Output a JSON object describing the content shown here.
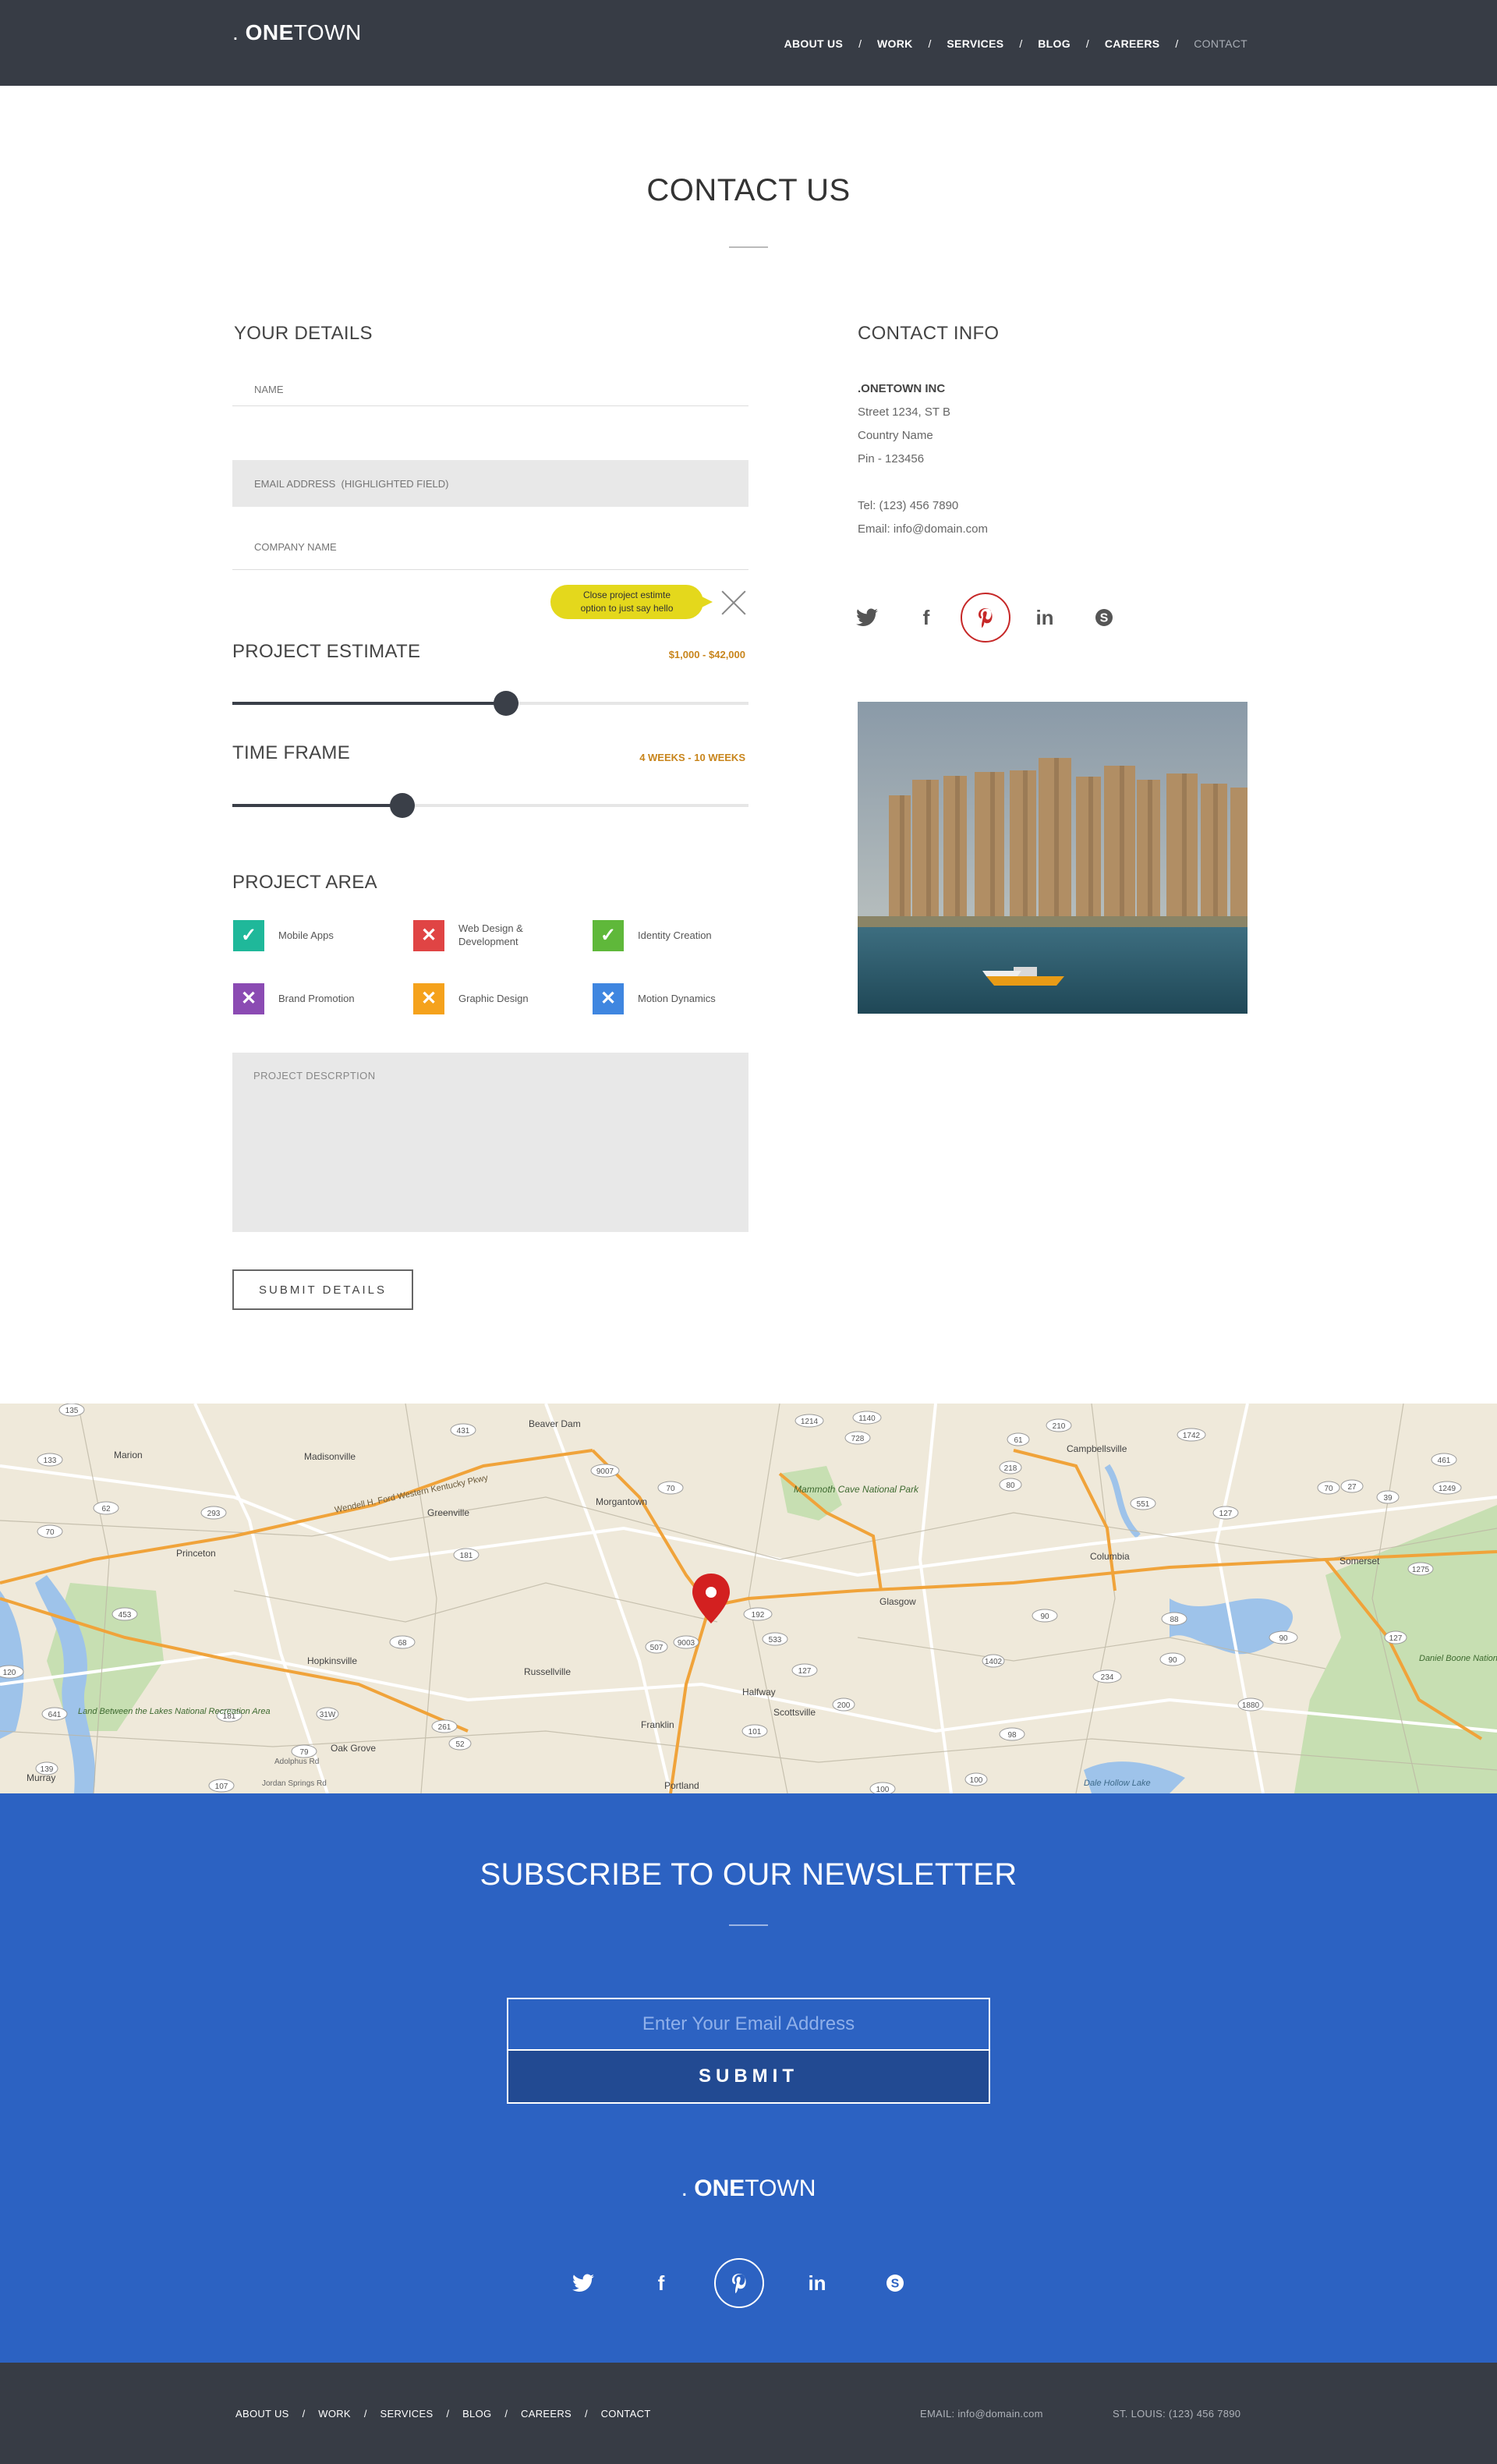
{
  "header": {
    "logo_dot": ". ",
    "logo_bold": "ONE",
    "logo_light": "TOWN",
    "nav": [
      "ABOUT US",
      "WORK",
      "SERVICES",
      "BLOG",
      "CAREERS",
      "CONTACT"
    ],
    "nav_sep": "/"
  },
  "page": {
    "title": "CONTACT US"
  },
  "form": {
    "heading": "YOUR DETAILS",
    "name_placeholder": "NAME",
    "email_placeholder": "EMAIL ADDRESS  (HIGHLIGHTED FIELD)",
    "company_placeholder": "COMPANY NAME",
    "tooltip_line1": "Close project estimte",
    "tooltip_line2": "option to just say hello",
    "estimate": {
      "heading": "PROJECT ESTIMATE",
      "range": "$1,000 - $42,000",
      "level": 0.53
    },
    "timeframe": {
      "heading": "TIME FRAME",
      "range": "4 WEEKS - 10 WEEKS",
      "level": 0.33
    },
    "project_area": {
      "heading": "PROJECT AREA",
      "items": [
        {
          "label": "Mobile Apps",
          "state": "checked",
          "color": "#1fb89a"
        },
        {
          "label": "Web Design & Development",
          "label1": "Web  Design &",
          "label2": "Development",
          "state": "unchecked",
          "color": "#e04444"
        },
        {
          "label": "Identity Creation",
          "state": "checked",
          "color": "#5fb83a"
        },
        {
          "label": "Brand Promotion",
          "state": "unchecked",
          "color": "#8b4bb3"
        },
        {
          "label": "Graphic Design",
          "state": "unchecked",
          "color": "#f5a21c"
        },
        {
          "label": "Motion Dynamics",
          "state": "unchecked",
          "color": "#3f86e0"
        }
      ]
    },
    "description_placeholder": "PROJECT DESCRPTION",
    "submit_label": "SUBMIT DETAILS"
  },
  "contact_info": {
    "heading": "CONTACT INFO",
    "company": ".ONETOWN  INC",
    "street": "Street  1234, ST B",
    "country": "Country Name",
    "pin": "Pin - 123456",
    "tel": "Tel:  (123) 456 7890",
    "email": "Email: info@domain.com",
    "social": [
      "twitter-icon",
      "facebook-icon",
      "pinterest-icon",
      "linkedin-icon",
      "skype-icon"
    ]
  },
  "map": {
    "places": [
      "Beaver Dam",
      "Madisonville",
      "Marion",
      "Princeton",
      "Greenville",
      "Morgantown",
      "Mammoth Cave National Park",
      "Campbellsville",
      "Columbia",
      "Somerset",
      "Glasgow",
      "Hopkinsville",
      "Russellville",
      "Halfway",
      "Scottsville",
      "Franklin",
      "Portland",
      "Oak Grove",
      "Murray",
      "Land Between the Lakes National Recreation Area",
      "Daniel Boone National Forest",
      "Dale Hollow Lake",
      "Wendell H. Ford Western Kentucky Pkwy",
      "Jordan Springs Rd",
      "Adolphus Rd"
    ],
    "routes": [
      "135",
      "133",
      "70",
      "453",
      "641",
      "62",
      "293",
      "431",
      "181",
      "9007",
      "70",
      "1214",
      "728",
      "1140",
      "61",
      "210",
      "1742",
      "461",
      "1249",
      "27",
      "70",
      "39",
      "80",
      "551",
      "127",
      "218",
      "88",
      "90",
      "127",
      "1275",
      "90",
      "192",
      "533",
      "1402",
      "234",
      "90",
      "1880",
      "127",
      "200",
      "101",
      "98",
      "100",
      "100",
      "52",
      "261",
      "79",
      "181",
      "107",
      "139",
      "120",
      "68",
      "9003",
      "507",
      "31W",
      "80",
      "24"
    ]
  },
  "newsletter": {
    "title": "SUBSCRIBE TO OUR NEWSLETTER",
    "email_placeholder": "Enter Your Email Address",
    "submit_label": "SUBMIT",
    "logo_dot": ". ",
    "logo_bold": "ONE",
    "logo_light": "TOWN",
    "social": [
      "twitter-icon",
      "facebook-icon",
      "pinterest-icon",
      "linkedin-icon",
      "skype-icon"
    ]
  },
  "footer": {
    "nav": [
      "ABOUT US",
      "WORK",
      "SERVICES",
      "BLOG",
      "CAREERS",
      "CONTACT"
    ],
    "nav_sep": "/",
    "email": "EMAIL: info@domain.com",
    "phone": "ST. LOUIS:  (123)  456  7890"
  },
  "colors": {
    "header_bg": "#373c45",
    "accent_orange": "#c8851c",
    "newsletter_bg": "#2c62c2",
    "tooltip_yellow": "#e4d81c",
    "pinterest_red": "#c62828"
  }
}
